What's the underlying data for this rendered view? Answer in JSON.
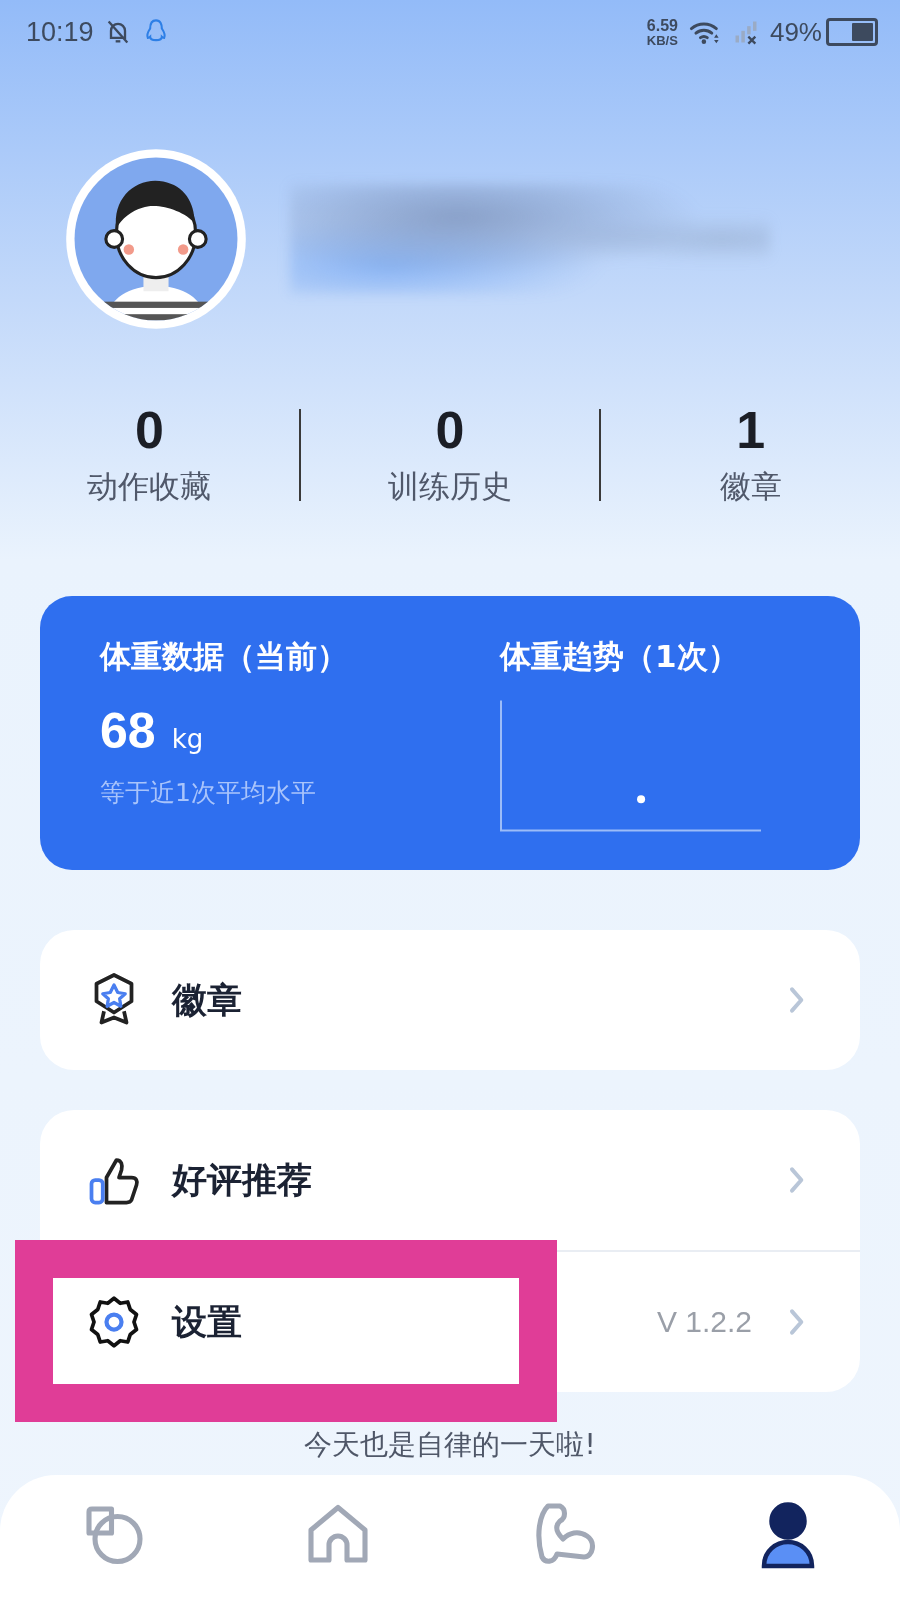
{
  "status_bar": {
    "time": "10:19",
    "net_speed": "6.59",
    "net_unit": "KB/S",
    "battery": "49%"
  },
  "stats": [
    {
      "value": "0",
      "label": "动作收藏"
    },
    {
      "value": "0",
      "label": "训练历史"
    },
    {
      "value": "1",
      "label": "徽章"
    }
  ],
  "weight_card": {
    "title": "体重数据（当前）",
    "value": "68",
    "unit": "kg",
    "note": "等于近1次平均水平",
    "trend_title": "体重趋势（1次）"
  },
  "menu_groups": [
    [
      {
        "kind": "badge",
        "label": "徽章"
      }
    ],
    [
      {
        "kind": "thumb",
        "label": "好评推荐"
      },
      {
        "kind": "gear",
        "label": "设置",
        "detail": "V 1.2.2"
      }
    ]
  ],
  "footer_text": "今天也是自律的一天啦!",
  "nav": {
    "items": [
      {
        "kind": "stats",
        "selected": false
      },
      {
        "kind": "home",
        "selected": false
      },
      {
        "kind": "muscle",
        "selected": false
      },
      {
        "kind": "profile",
        "selected": true
      }
    ]
  }
}
